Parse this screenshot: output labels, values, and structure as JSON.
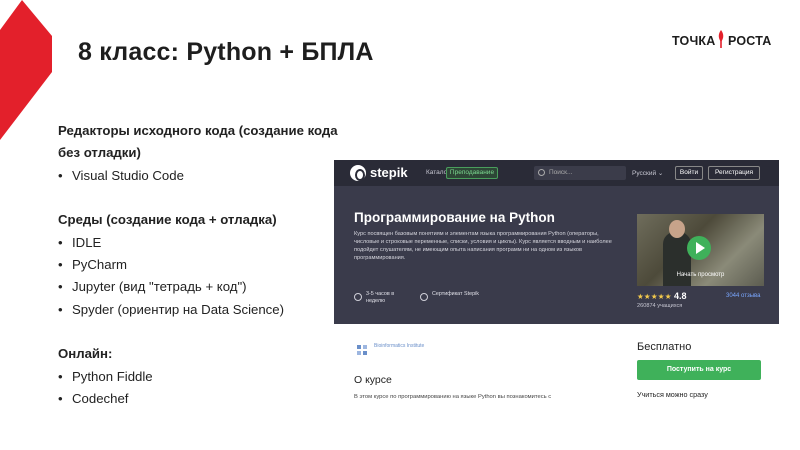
{
  "slide": {
    "title": "8 класс: Python + БПЛА",
    "logo_left": "ТОЧКА",
    "logo_right": "РОСТА"
  },
  "content": {
    "editors_heading": "Редакторы исходного кода (создание кода без отладки)",
    "editors": [
      "Visual Studio Code"
    ],
    "ides_heading": "Среды (создание кода + отладка)",
    "ides": [
      "IDLE",
      "PyCharm",
      "Jupyter (вид \"тетрадь + код\")",
      "Spyder (ориентир на Data Science)"
    ],
    "online_heading": "Онлайн:",
    "online": [
      "Python Fiddle",
      "Codechef"
    ]
  },
  "stepik": {
    "brand": "stepik",
    "nav_catalog": "Каталог",
    "nav_teach": "Преподавание",
    "search_placeholder": "Поиск...",
    "language": "Русский ⌄",
    "login": "Войти",
    "register": "Регистрация",
    "course_title": "Программирование на Python",
    "course_desc": "Курс посвящен базовым понятиям и элементам языка программирования Python (операторы, числовые и строковые переменные, списки, условия и циклы). Курс является вводным и наиболее подойдет слушателям, не имеющим опыта написания программ ни на одном из языков программирования.",
    "meta_hours": "3-5 часов в неделю",
    "meta_cert": "Сертификат Stepik",
    "video_caption": "Начать просмотр",
    "stars": "★★★★★",
    "rating": "4.8",
    "reviews": "3044 отзыва",
    "learners": "260874 учащихся",
    "provider": "Bioinformatics Institute",
    "about_title": "О курсе",
    "about_text": "В этом курсе по программированию на языке Python вы познакомитесь с",
    "price": "Бесплатно",
    "enroll": "Поступить на курс",
    "learn_more": "Учиться можно сразу"
  },
  "colors": {
    "brand_red": "#e3202b",
    "stepik_green": "#3fb15a",
    "hero_bg": "#3a3b4b"
  }
}
